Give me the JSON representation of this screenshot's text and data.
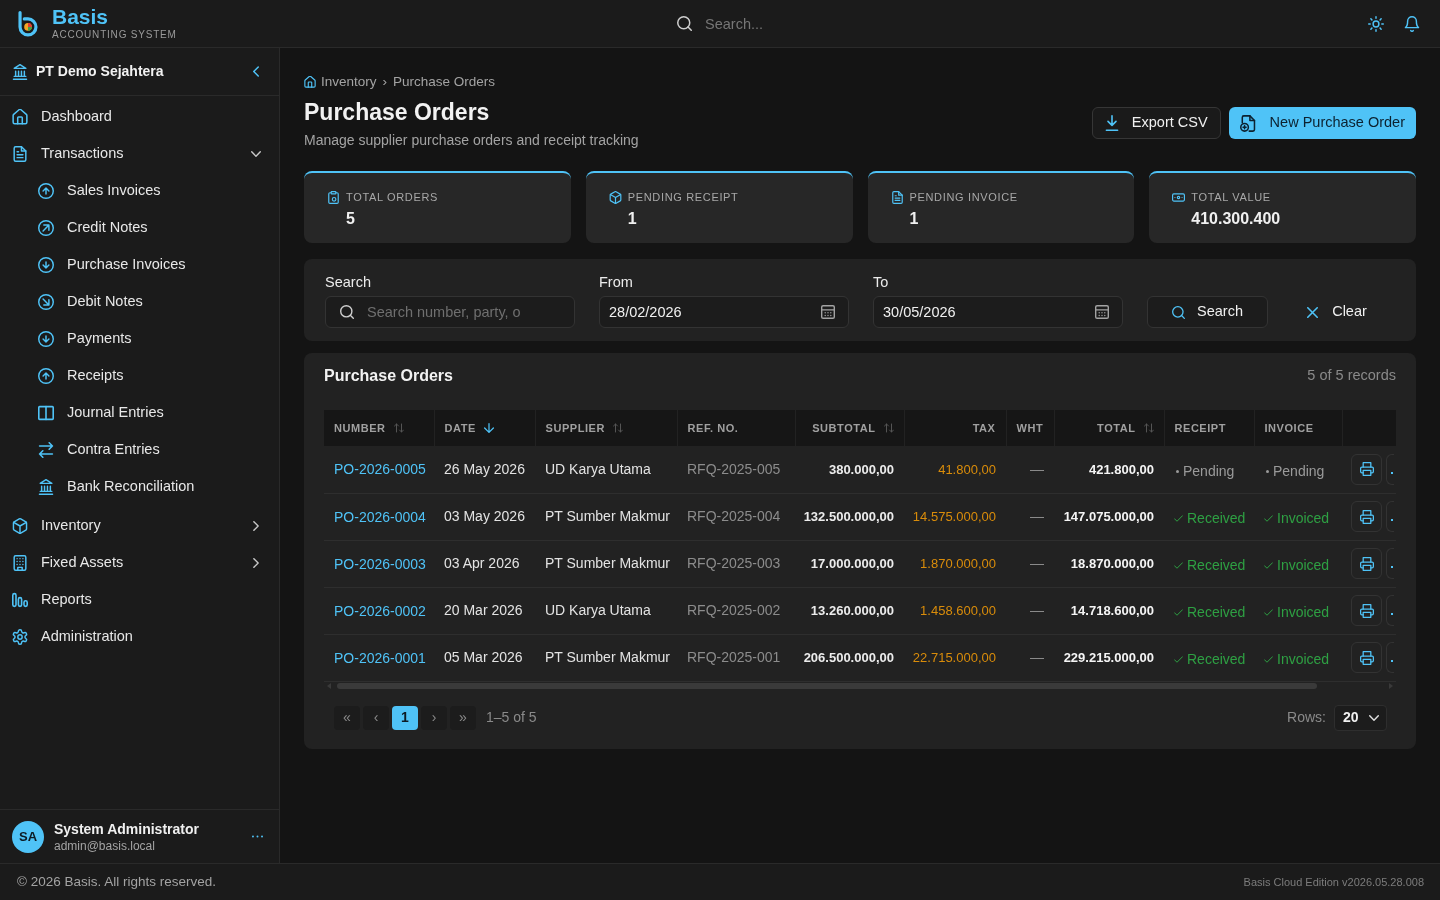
{
  "header": {
    "app_title": "Basis",
    "app_subtitle": "ACCOUNTING SYSTEM",
    "search": {
      "placeholder": "Search..."
    }
  },
  "sidebar": {
    "company": "PT Demo Sejahtera",
    "items": [
      {
        "label": "Dashboard",
        "kind": "link"
      },
      {
        "label": "Transactions",
        "kind": "group",
        "expanded": true,
        "children": [
          {
            "label": "Sales Invoices"
          },
          {
            "label": "Credit Notes"
          },
          {
            "label": "Purchase Invoices"
          },
          {
            "label": "Debit Notes"
          },
          {
            "label": "Payments"
          },
          {
            "label": "Receipts"
          },
          {
            "label": "Journal Entries"
          },
          {
            "label": "Contra Entries"
          },
          {
            "label": "Bank Reconciliation"
          }
        ]
      },
      {
        "label": "Inventory",
        "kind": "group",
        "expanded": false
      },
      {
        "label": "Fixed Assets",
        "kind": "group",
        "expanded": false
      },
      {
        "label": "Reports",
        "kind": "link"
      },
      {
        "label": "Administration",
        "kind": "link"
      }
    ],
    "user": {
      "initials": "SA",
      "name": "System Administrator",
      "email": "admin@basis.local"
    }
  },
  "breadcrumb": {
    "items": [
      "Inventory",
      "Purchase Orders"
    ],
    "separator": "›"
  },
  "page": {
    "title": "Purchase Orders",
    "subtitle": "Manage supplier purchase orders and receipt tracking",
    "actions": [
      {
        "label": "Export CSV",
        "kind": "secondary"
      },
      {
        "label": "New Purchase Order",
        "kind": "primary"
      }
    ]
  },
  "stats": [
    {
      "label": "TOTAL ORDERS",
      "value": "5"
    },
    {
      "label": "PENDING RECEIPT",
      "value": "1"
    },
    {
      "label": "PENDING INVOICE",
      "value": "1"
    },
    {
      "label": "TOTAL VALUE",
      "value": "410.300.400"
    }
  ],
  "filters": {
    "fields": [
      {
        "label": "Search",
        "kind": "text",
        "placeholder": "Search number, party, o"
      },
      {
        "label": "From",
        "kind": "date",
        "value": "28/02/2026"
      },
      {
        "label": "To",
        "kind": "date",
        "value": "30/05/2026"
      }
    ],
    "buttons": [
      {
        "label": "Search",
        "kind": "outlined"
      },
      {
        "label": "Clear",
        "kind": "plain"
      }
    ]
  },
  "table": {
    "title": "Purchase Orders",
    "record_count": "5 of 5 records",
    "columns": [
      {
        "label": "NUMBER",
        "sortable": true,
        "sorted": false
      },
      {
        "label": "DATE",
        "sortable": true,
        "sorted": true
      },
      {
        "label": "SUPPLIER",
        "sortable": true,
        "sorted": false
      },
      {
        "label": "REF. NO.",
        "sortable": false
      },
      {
        "label": "SUBTOTAL",
        "sortable": true,
        "sorted": false
      },
      {
        "label": "TAX",
        "sortable": false
      },
      {
        "label": "WHT",
        "sortable": false
      },
      {
        "label": "TOTAL",
        "sortable": true,
        "sorted": false
      },
      {
        "label": "RECEIPT",
        "sortable": false
      },
      {
        "label": "INVOICE",
        "sortable": false
      }
    ],
    "rows": [
      {
        "number": "PO-2026-0005",
        "date": "26 May 2026",
        "supplier": "UD Karya Utama",
        "ref_no": "RFQ-2025-005",
        "subtotal": "380.000,00",
        "tax": "41.800,00",
        "wht": "—",
        "total": "421.800,00",
        "receipt": {
          "label": "Pending",
          "kind": "pending"
        },
        "invoice": {
          "label": "Pending",
          "kind": "pending"
        }
      },
      {
        "number": "PO-2026-0004",
        "date": "03 May 2026",
        "supplier": "PT Sumber Makmur",
        "ref_no": "RFQ-2025-004",
        "subtotal": "132.500.000,00",
        "tax": "14.575.000,00",
        "wht": "—",
        "total": "147.075.000,00",
        "receipt": {
          "label": "Received",
          "kind": "done"
        },
        "invoice": {
          "label": "Invoiced",
          "kind": "done"
        }
      },
      {
        "number": "PO-2026-0003",
        "date": "03 Apr 2026",
        "supplier": "PT Sumber Makmur",
        "ref_no": "RFQ-2025-003",
        "subtotal": "17.000.000,00",
        "tax": "1.870.000,00",
        "wht": "—",
        "total": "18.870.000,00",
        "receipt": {
          "label": "Received",
          "kind": "done"
        },
        "invoice": {
          "label": "Invoiced",
          "kind": "done"
        }
      },
      {
        "number": "PO-2026-0002",
        "date": "20 Mar 2026",
        "supplier": "UD Karya Utama",
        "ref_no": "RFQ-2025-002",
        "subtotal": "13.260.000,00",
        "tax": "1.458.600,00",
        "wht": "—",
        "total": "14.718.600,00",
        "receipt": {
          "label": "Received",
          "kind": "done"
        },
        "invoice": {
          "label": "Invoiced",
          "kind": "done"
        }
      },
      {
        "number": "PO-2026-0001",
        "date": "05 Mar 2026",
        "supplier": "PT Sumber Makmur",
        "ref_no": "RFQ-2025-001",
        "subtotal": "206.500.000,00",
        "tax": "22.715.000,00",
        "wht": "—",
        "total": "229.215.000,00",
        "receipt": {
          "label": "Received",
          "kind": "done"
        },
        "invoice": {
          "label": "Invoiced",
          "kind": "done"
        }
      }
    ],
    "pagination": {
      "first": "«",
      "previous": "‹",
      "pages": [
        {
          "label": "1",
          "selected": true
        }
      ],
      "next": "›",
      "last": "»",
      "range": "1–5 of 5"
    },
    "rows_per_page": {
      "label": "Rows:",
      "value": "20"
    }
  },
  "footer": {
    "copyright": "© 2026 Basis. All rights reserved.",
    "version": "Basis Cloud Edition v2026.05.28.008"
  }
}
